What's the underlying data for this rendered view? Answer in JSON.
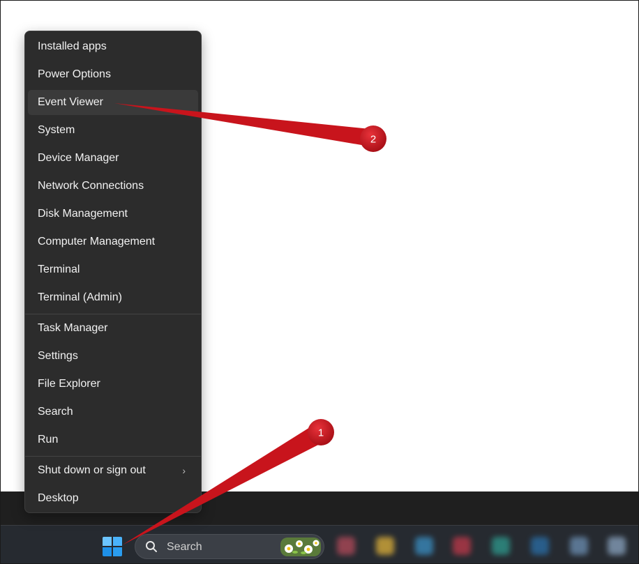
{
  "context_menu": {
    "items": [
      {
        "label": "Installed apps"
      },
      {
        "label": "Power Options"
      },
      {
        "label": "Event Viewer"
      },
      {
        "label": "System"
      },
      {
        "label": "Device Manager"
      },
      {
        "label": "Network Connections"
      },
      {
        "label": "Disk Management"
      },
      {
        "label": "Computer Management"
      },
      {
        "label": "Terminal"
      },
      {
        "label": "Terminal (Admin)"
      },
      {
        "label": "Task Manager"
      },
      {
        "label": "Settings"
      },
      {
        "label": "File Explorer"
      },
      {
        "label": "Search"
      },
      {
        "label": "Run"
      },
      {
        "label": "Shut down or sign out"
      },
      {
        "label": "Desktop"
      }
    ],
    "submenu_chevron": "›",
    "highlighted_item": "Event Viewer"
  },
  "taskbar": {
    "start_icon": "windows-logo-icon",
    "search_placeholder": "Search",
    "search_icon": "search-icon"
  },
  "annotations": {
    "step1_label": "1",
    "step2_label": "2",
    "color": "#c8141c"
  }
}
